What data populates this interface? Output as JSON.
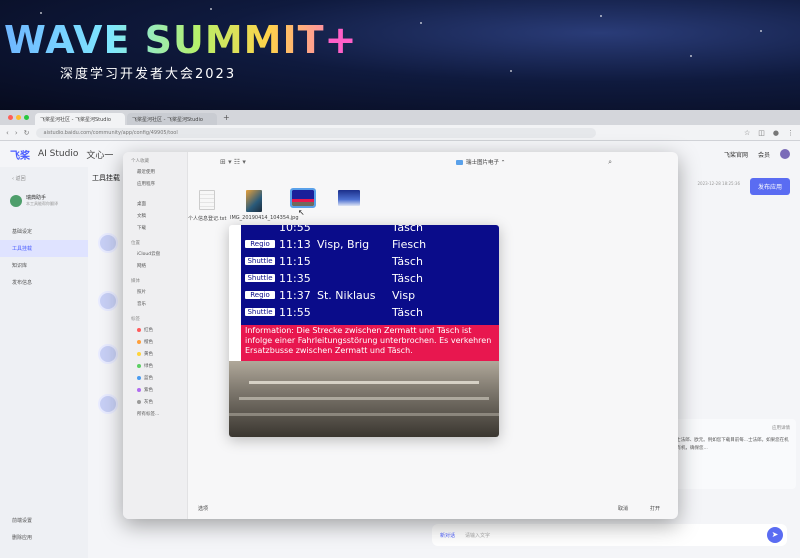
{
  "banner": {
    "title": "WAVE SUMMIT",
    "plus": "+",
    "subtitle": "深度学习开发者大会2023"
  },
  "browser": {
    "tabs": [
      "飞桨星河社区 - 飞桨星河Studio",
      "飞桨星河社区 - 飞桨星河Studio"
    ],
    "tab_add": "+",
    "url": "aistudio.baidu.com/community/app/config/49905/tool"
  },
  "app": {
    "logo": "飞桨",
    "studio": "AI Studio",
    "nav_tab": "文心一",
    "header_right": [
      "飞桨官网",
      "会员"
    ],
    "sidebar": {
      "back": "返回",
      "agent_name": "瑞典助手",
      "agent_desc": "本工具能帮你翻译",
      "items": [
        "基础设定",
        "工具挂载",
        "知识库",
        "发布信息"
      ],
      "active_index": 1,
      "bottom_items": [
        "前端设置",
        "删除应用"
      ]
    },
    "main_title": "工具挂载",
    "update_time": "2023-12-28 18:25:36",
    "publish_label": "发布应用",
    "right_panel": {
      "title": "应用详情",
      "text": "...士法郎、欧元。例如您下载目前每...士法郎。如果您在机场有机，确保您..."
    },
    "chat": {
      "new_chat": "新对话",
      "placeholder": "请输入文字"
    }
  },
  "dialog": {
    "sidebar": {
      "sections": [
        {
          "title": "个人收藏",
          "items": [
            "最近使用",
            "应用程序"
          ]
        },
        {
          "title": "",
          "items": [
            "桌面",
            "文稿",
            "下载"
          ]
        },
        {
          "title": "位置",
          "items": [
            "iCloud云盘",
            "网络"
          ]
        },
        {
          "title": "媒体",
          "items": [
            "照片",
            "音乐"
          ]
        },
        {
          "title": "标签",
          "items": [
            "红色",
            "橙色",
            "黄色",
            "绿色",
            "蓝色",
            "紫色",
            "灰色",
            "所有标签..."
          ]
        }
      ],
      "tag_colors": [
        "#ff5b5b",
        "#ff9f3a",
        "#ffd43a",
        "#5ccf63",
        "#4a9bf0",
        "#b06bf0",
        "#9a9a9a"
      ]
    },
    "folder": "瑞士图片电子",
    "thumbs": [
      {
        "label": "个人信息登记.txt",
        "kind": "doc"
      },
      {
        "label": "",
        "kind": "poster"
      },
      {
        "label": "IMG_20190414_104354.jpg",
        "kind": "board",
        "selected": true
      },
      {
        "label": "",
        "kind": "sky"
      }
    ],
    "preview": {
      "rows": [
        {
          "type": "",
          "time": "10:55",
          "via": "",
          "dest": "Täsch"
        },
        {
          "type": "Regio",
          "time": "11:13",
          "via": "Visp, Brig",
          "dest": "Fiesch"
        },
        {
          "type": "Shuttle",
          "time": "11:15",
          "via": "",
          "dest": "Täsch"
        },
        {
          "type": "Shuttle",
          "time": "11:35",
          "via": "",
          "dest": "Täsch"
        },
        {
          "type": "Regio",
          "time": "11:37",
          "via": "St. Niklaus",
          "dest": "Visp"
        },
        {
          "type": "Shuttle",
          "time": "11:55",
          "via": "",
          "dest": "Täsch"
        }
      ],
      "info": "Information: Die Strecke zwischen Zermatt und Täsch ist infolge einer Fahrleitungsstörung unterbrochen. Es verkehren Ersatzbusse zwischen Zermatt und Täsch."
    },
    "footer": {
      "options": "选项",
      "cancel": "取消",
      "open": "打开"
    }
  }
}
